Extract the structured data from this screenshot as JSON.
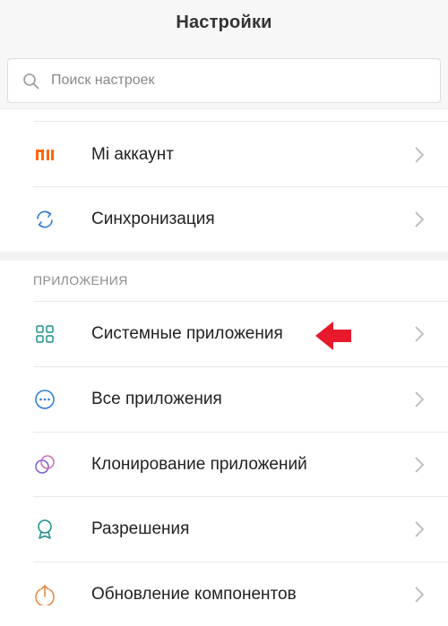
{
  "header": {
    "title": "Настройки"
  },
  "search": {
    "placeholder": "Поиск настроек"
  },
  "account_items": [
    {
      "label": "Mi аккаунт",
      "icon": "mi-logo-icon"
    },
    {
      "label": "Синхронизация",
      "icon": "sync-icon"
    }
  ],
  "apps_section": {
    "header": "ПРИЛОЖЕНИЯ",
    "items": [
      {
        "label": "Системные приложения",
        "icon": "grid-apps-icon"
      },
      {
        "label": "Все приложения",
        "icon": "more-dots-icon"
      },
      {
        "label": "Клонирование приложений",
        "icon": "dual-circles-icon"
      },
      {
        "label": "Разрешения",
        "icon": "ribbon-badge-icon"
      },
      {
        "label": "Обновление компонентов",
        "icon": "upload-arrow-icon"
      }
    ]
  },
  "colors": {
    "mi_orange": "#ff6700",
    "icon_teal": "#1e8f8a",
    "icon_blue": "#2c7bd6",
    "annotation_red": "#e8192c"
  }
}
